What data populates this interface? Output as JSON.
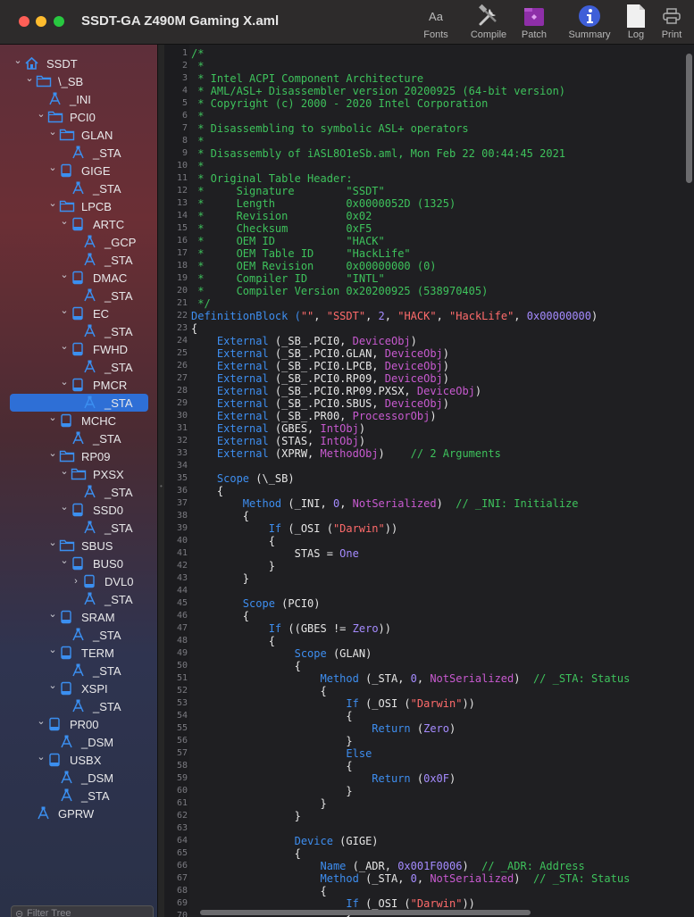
{
  "window": {
    "title": "SSDT-GA Z490M Gaming X.aml"
  },
  "toolbar": {
    "fonts": "Fonts",
    "compile": "Compile",
    "patch": "Patch",
    "summary": "Summary",
    "log": "Log",
    "print": "Print",
    "fonts_glyph": "Aa"
  },
  "tree": {
    "items": [
      {
        "label": "SSDT",
        "icon": "house-icon",
        "arrow": "down"
      },
      {
        "label": "\\_SB",
        "icon": "folder-icon",
        "arrow": "down"
      },
      {
        "label": "_INI",
        "icon": "method-icon",
        "arrow": ""
      },
      {
        "label": "PCI0",
        "icon": "folder-icon",
        "arrow": "down"
      },
      {
        "label": "GLAN",
        "icon": "folder-icon",
        "arrow": "down"
      },
      {
        "label": "_STA",
        "icon": "method-icon",
        "arrow": ""
      },
      {
        "label": "GIGE",
        "icon": "device-icon",
        "arrow": "down"
      },
      {
        "label": "_STA",
        "icon": "method-icon",
        "arrow": ""
      },
      {
        "label": "LPCB",
        "icon": "folder-icon",
        "arrow": "down"
      },
      {
        "label": "ARTC",
        "icon": "device-icon",
        "arrow": "down"
      },
      {
        "label": "_GCP",
        "icon": "method-icon",
        "arrow": ""
      },
      {
        "label": "_STA",
        "icon": "method-icon",
        "arrow": ""
      },
      {
        "label": "DMAC",
        "icon": "device-icon",
        "arrow": "down"
      },
      {
        "label": "_STA",
        "icon": "method-icon",
        "arrow": ""
      },
      {
        "label": "EC",
        "icon": "device-icon",
        "arrow": "down"
      },
      {
        "label": "_STA",
        "icon": "method-icon",
        "arrow": ""
      },
      {
        "label": "FWHD",
        "icon": "device-icon",
        "arrow": "down"
      },
      {
        "label": "_STA",
        "icon": "method-icon",
        "arrow": ""
      },
      {
        "label": "PMCR",
        "icon": "device-icon",
        "arrow": "down"
      },
      {
        "label": "_STA",
        "icon": "method-icon",
        "arrow": "",
        "selected": true
      },
      {
        "label": "MCHC",
        "icon": "device-icon",
        "arrow": "down"
      },
      {
        "label": "_STA",
        "icon": "method-icon",
        "arrow": ""
      },
      {
        "label": "RP09",
        "icon": "folder-icon",
        "arrow": "down"
      },
      {
        "label": "PXSX",
        "icon": "folder-icon",
        "arrow": "down"
      },
      {
        "label": "_STA",
        "icon": "method-icon",
        "arrow": ""
      },
      {
        "label": "SSD0",
        "icon": "device-icon",
        "arrow": "down"
      },
      {
        "label": "_STA",
        "icon": "method-icon",
        "arrow": ""
      },
      {
        "label": "SBUS",
        "icon": "folder-icon",
        "arrow": "down"
      },
      {
        "label": "BUS0",
        "icon": "device-icon",
        "arrow": "down"
      },
      {
        "label": "DVL0",
        "icon": "device-icon",
        "arrow": "right"
      },
      {
        "label": "_STA",
        "icon": "method-icon",
        "arrow": ""
      },
      {
        "label": "SRAM",
        "icon": "device-icon",
        "arrow": "down"
      },
      {
        "label": "_STA",
        "icon": "method-icon",
        "arrow": ""
      },
      {
        "label": "TERM",
        "icon": "device-icon",
        "arrow": "down"
      },
      {
        "label": "_STA",
        "icon": "method-icon",
        "arrow": ""
      },
      {
        "label": "XSPI",
        "icon": "device-icon",
        "arrow": "down"
      },
      {
        "label": "_STA",
        "icon": "method-icon",
        "arrow": ""
      },
      {
        "label": "PR00",
        "icon": "device-icon",
        "arrow": "down"
      },
      {
        "label": "_DSM",
        "icon": "method-icon",
        "arrow": ""
      },
      {
        "label": "USBX",
        "icon": "device-icon",
        "arrow": "down"
      },
      {
        "label": "_DSM",
        "icon": "method-icon",
        "arrow": ""
      },
      {
        "label": "_STA",
        "icon": "method-icon",
        "arrow": ""
      },
      {
        "label": "GPRW",
        "icon": "method-icon",
        "arrow": ""
      }
    ],
    "filter_placeholder": "Filter Tree"
  },
  "code": {
    "lines": [
      [
        [
          "/*",
          "c"
        ]
      ],
      [
        [
          " * ",
          "c"
        ]
      ],
      [
        [
          " * Intel ACPI Component Architecture",
          "c"
        ]
      ],
      [
        [
          " * AML/ASL+ Disassembler version 20200925 (64-bit version)",
          "c"
        ]
      ],
      [
        [
          " * Copyright (c) 2000 - 2020 Intel Corporation",
          "c"
        ]
      ],
      [
        [
          " * ",
          "c"
        ]
      ],
      [
        [
          " * Disassembling to symbolic ASL+ operators",
          "c"
        ]
      ],
      [
        [
          " * ",
          "c"
        ]
      ],
      [
        [
          " * Disassembly of iASL8O1eSb.aml, Mon Feb 22 00:44:45 2021",
          "c"
        ]
      ],
      [
        [
          " * ",
          "c"
        ]
      ],
      [
        [
          " * Original Table Header:",
          "c"
        ]
      ],
      [
        [
          " *     Signature        \"SSDT\"",
          "c"
        ]
      ],
      [
        [
          " *     Length           0x0000052D (1325)",
          "c"
        ]
      ],
      [
        [
          " *     Revision         0x02",
          "c"
        ]
      ],
      [
        [
          " *     Checksum         0xF5",
          "c"
        ]
      ],
      [
        [
          " *     OEM ID           \"HACK\"",
          "c"
        ]
      ],
      [
        [
          " *     OEM Table ID     \"HackLife\"",
          "c"
        ]
      ],
      [
        [
          " *     OEM Revision     0x00000000 (0)",
          "c"
        ]
      ],
      [
        [
          " *     Compiler ID      \"INTL\"",
          "c"
        ]
      ],
      [
        [
          " *     Compiler Version 0x20200925 (538970405)",
          "c"
        ]
      ],
      [
        [
          " */",
          "c"
        ]
      ],
      [
        [
          "DefinitionBlock (",
          "k"
        ],
        [
          "\"\"",
          "s"
        ],
        [
          ", ",
          "p"
        ],
        [
          "\"SSDT\"",
          "s"
        ],
        [
          ", ",
          "p"
        ],
        [
          "2",
          "n"
        ],
        [
          ", ",
          "p"
        ],
        [
          "\"HACK\"",
          "s"
        ],
        [
          ", ",
          "p"
        ],
        [
          "\"HackLife\"",
          "s"
        ],
        [
          ", ",
          "p"
        ],
        [
          "0x00000000",
          "n"
        ],
        [
          ")",
          "p"
        ]
      ],
      [
        [
          "{",
          "p"
        ]
      ],
      [
        [
          "    External",
          "k"
        ],
        [
          " (_SB_.PCI0, ",
          "p"
        ],
        [
          "DeviceObj",
          "t"
        ],
        [
          ")",
          "p"
        ]
      ],
      [
        [
          "    External",
          "k"
        ],
        [
          " (_SB_.PCI0.GLAN, ",
          "p"
        ],
        [
          "DeviceObj",
          "t"
        ],
        [
          ")",
          "p"
        ]
      ],
      [
        [
          "    External",
          "k"
        ],
        [
          " (_SB_.PCI0.LPCB, ",
          "p"
        ],
        [
          "DeviceObj",
          "t"
        ],
        [
          ")",
          "p"
        ]
      ],
      [
        [
          "    External",
          "k"
        ],
        [
          " (_SB_.PCI0.RP09, ",
          "p"
        ],
        [
          "DeviceObj",
          "t"
        ],
        [
          ")",
          "p"
        ]
      ],
      [
        [
          "    External",
          "k"
        ],
        [
          " (_SB_.PCI0.RP09.PXSX, ",
          "p"
        ],
        [
          "DeviceObj",
          "t"
        ],
        [
          ")",
          "p"
        ]
      ],
      [
        [
          "    External",
          "k"
        ],
        [
          " (_SB_.PCI0.SBUS, ",
          "p"
        ],
        [
          "DeviceObj",
          "t"
        ],
        [
          ")",
          "p"
        ]
      ],
      [
        [
          "    External",
          "k"
        ],
        [
          " (_SB_.PR00, ",
          "p"
        ],
        [
          "ProcessorObj",
          "t"
        ],
        [
          ")",
          "p"
        ]
      ],
      [
        [
          "    External",
          "k"
        ],
        [
          " (GBES, ",
          "p"
        ],
        [
          "IntObj",
          "t"
        ],
        [
          ")",
          "p"
        ]
      ],
      [
        [
          "    External",
          "k"
        ],
        [
          " (STAS, ",
          "p"
        ],
        [
          "IntObj",
          "t"
        ],
        [
          ")",
          "p"
        ]
      ],
      [
        [
          "    External",
          "k"
        ],
        [
          " (XPRW, ",
          "p"
        ],
        [
          "MethodObj",
          "t"
        ],
        [
          ")    ",
          "p"
        ],
        [
          "// 2 Arguments",
          "c"
        ]
      ],
      [
        [
          "",
          "p"
        ]
      ],
      [
        [
          "    Scope",
          "k"
        ],
        [
          " (\\_SB)",
          "p"
        ]
      ],
      [
        [
          "    {",
          "p"
        ]
      ],
      [
        [
          "        Method",
          "k"
        ],
        [
          " (_INI, ",
          "p"
        ],
        [
          "0",
          "n"
        ],
        [
          ", ",
          "p"
        ],
        [
          "NotSerialized",
          "t"
        ],
        [
          ")  ",
          "p"
        ],
        [
          "// _INI: Initialize",
          "c"
        ]
      ],
      [
        [
          "        {",
          "p"
        ]
      ],
      [
        [
          "            If",
          "k"
        ],
        [
          " (_OSI (",
          "p"
        ],
        [
          "\"Darwin\"",
          "s"
        ],
        [
          "))",
          "p"
        ]
      ],
      [
        [
          "            {",
          "p"
        ]
      ],
      [
        [
          "                STAS = ",
          "p"
        ],
        [
          "One",
          "n"
        ]
      ],
      [
        [
          "            }",
          "p"
        ]
      ],
      [
        [
          "        }",
          "p"
        ]
      ],
      [
        [
          "",
          "p"
        ]
      ],
      [
        [
          "        Scope",
          "k"
        ],
        [
          " (PCI0)",
          "p"
        ]
      ],
      [
        [
          "        {",
          "p"
        ]
      ],
      [
        [
          "            If",
          "k"
        ],
        [
          " ((GBES != ",
          "p"
        ],
        [
          "Zero",
          "n"
        ],
        [
          "))",
          "p"
        ]
      ],
      [
        [
          "            {",
          "p"
        ]
      ],
      [
        [
          "                Scope",
          "k"
        ],
        [
          " (GLAN)",
          "p"
        ]
      ],
      [
        [
          "                {",
          "p"
        ]
      ],
      [
        [
          "                    Method",
          "k"
        ],
        [
          " (_STA, ",
          "p"
        ],
        [
          "0",
          "n"
        ],
        [
          ", ",
          "p"
        ],
        [
          "NotSerialized",
          "t"
        ],
        [
          ")  ",
          "p"
        ],
        [
          "// _STA: Status",
          "c"
        ]
      ],
      [
        [
          "                    {",
          "p"
        ]
      ],
      [
        [
          "                        If",
          "k"
        ],
        [
          " (_OSI (",
          "p"
        ],
        [
          "\"Darwin\"",
          "s"
        ],
        [
          "))",
          "p"
        ]
      ],
      [
        [
          "                        {",
          "p"
        ]
      ],
      [
        [
          "                            Return",
          "k"
        ],
        [
          " (",
          "p"
        ],
        [
          "Zero",
          "n"
        ],
        [
          ")",
          "p"
        ]
      ],
      [
        [
          "                        }",
          "p"
        ]
      ],
      [
        [
          "                        Else",
          "k"
        ]
      ],
      [
        [
          "                        {",
          "p"
        ]
      ],
      [
        [
          "                            Return",
          "k"
        ],
        [
          " (",
          "p"
        ],
        [
          "0x0F",
          "n"
        ],
        [
          ")",
          "p"
        ]
      ],
      [
        [
          "                        }",
          "p"
        ]
      ],
      [
        [
          "                    }",
          "p"
        ]
      ],
      [
        [
          "                }",
          "p"
        ]
      ],
      [
        [
          "",
          "p"
        ]
      ],
      [
        [
          "                Device",
          "k"
        ],
        [
          " (GIGE)",
          "p"
        ]
      ],
      [
        [
          "                {",
          "p"
        ]
      ],
      [
        [
          "                    Name",
          "k"
        ],
        [
          " (_ADR, ",
          "p"
        ],
        [
          "0x001F0006",
          "n"
        ],
        [
          ")  ",
          "p"
        ],
        [
          "// _ADR: Address",
          "c"
        ]
      ],
      [
        [
          "                    Method",
          "k"
        ],
        [
          " (_STA, ",
          "p"
        ],
        [
          "0",
          "n"
        ],
        [
          ", ",
          "p"
        ],
        [
          "NotSerialized",
          "t"
        ],
        [
          ")  ",
          "p"
        ],
        [
          "// _STA: Status",
          "c"
        ]
      ],
      [
        [
          "                    {",
          "p"
        ]
      ],
      [
        [
          "                        If",
          "k"
        ],
        [
          " (_OSI (",
          "p"
        ],
        [
          "\"Darwin\"",
          "s"
        ],
        [
          "))",
          "p"
        ]
      ],
      [
        [
          "                        {",
          "p"
        ]
      ]
    ]
  }
}
